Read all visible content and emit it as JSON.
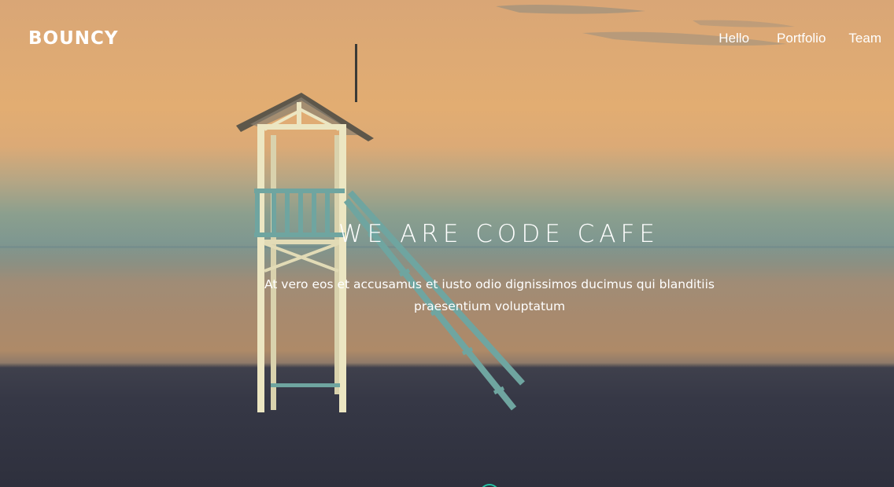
{
  "header": {
    "logo": "BOUNCY",
    "nav": [
      {
        "label": "Hello"
      },
      {
        "label": "Portfolio"
      },
      {
        "label": "Team"
      }
    ]
  },
  "hero": {
    "title": "WE ARE CODE CAFE",
    "subtitle": "At vero eos et accusamus et iusto odio dignissimos ducimus qui blanditiis praesentium voluptatum"
  },
  "colors": {
    "accent": "#22c1a3",
    "sky": "#e2ad72",
    "sea": "#7e9790",
    "sand": "#2e303d"
  }
}
